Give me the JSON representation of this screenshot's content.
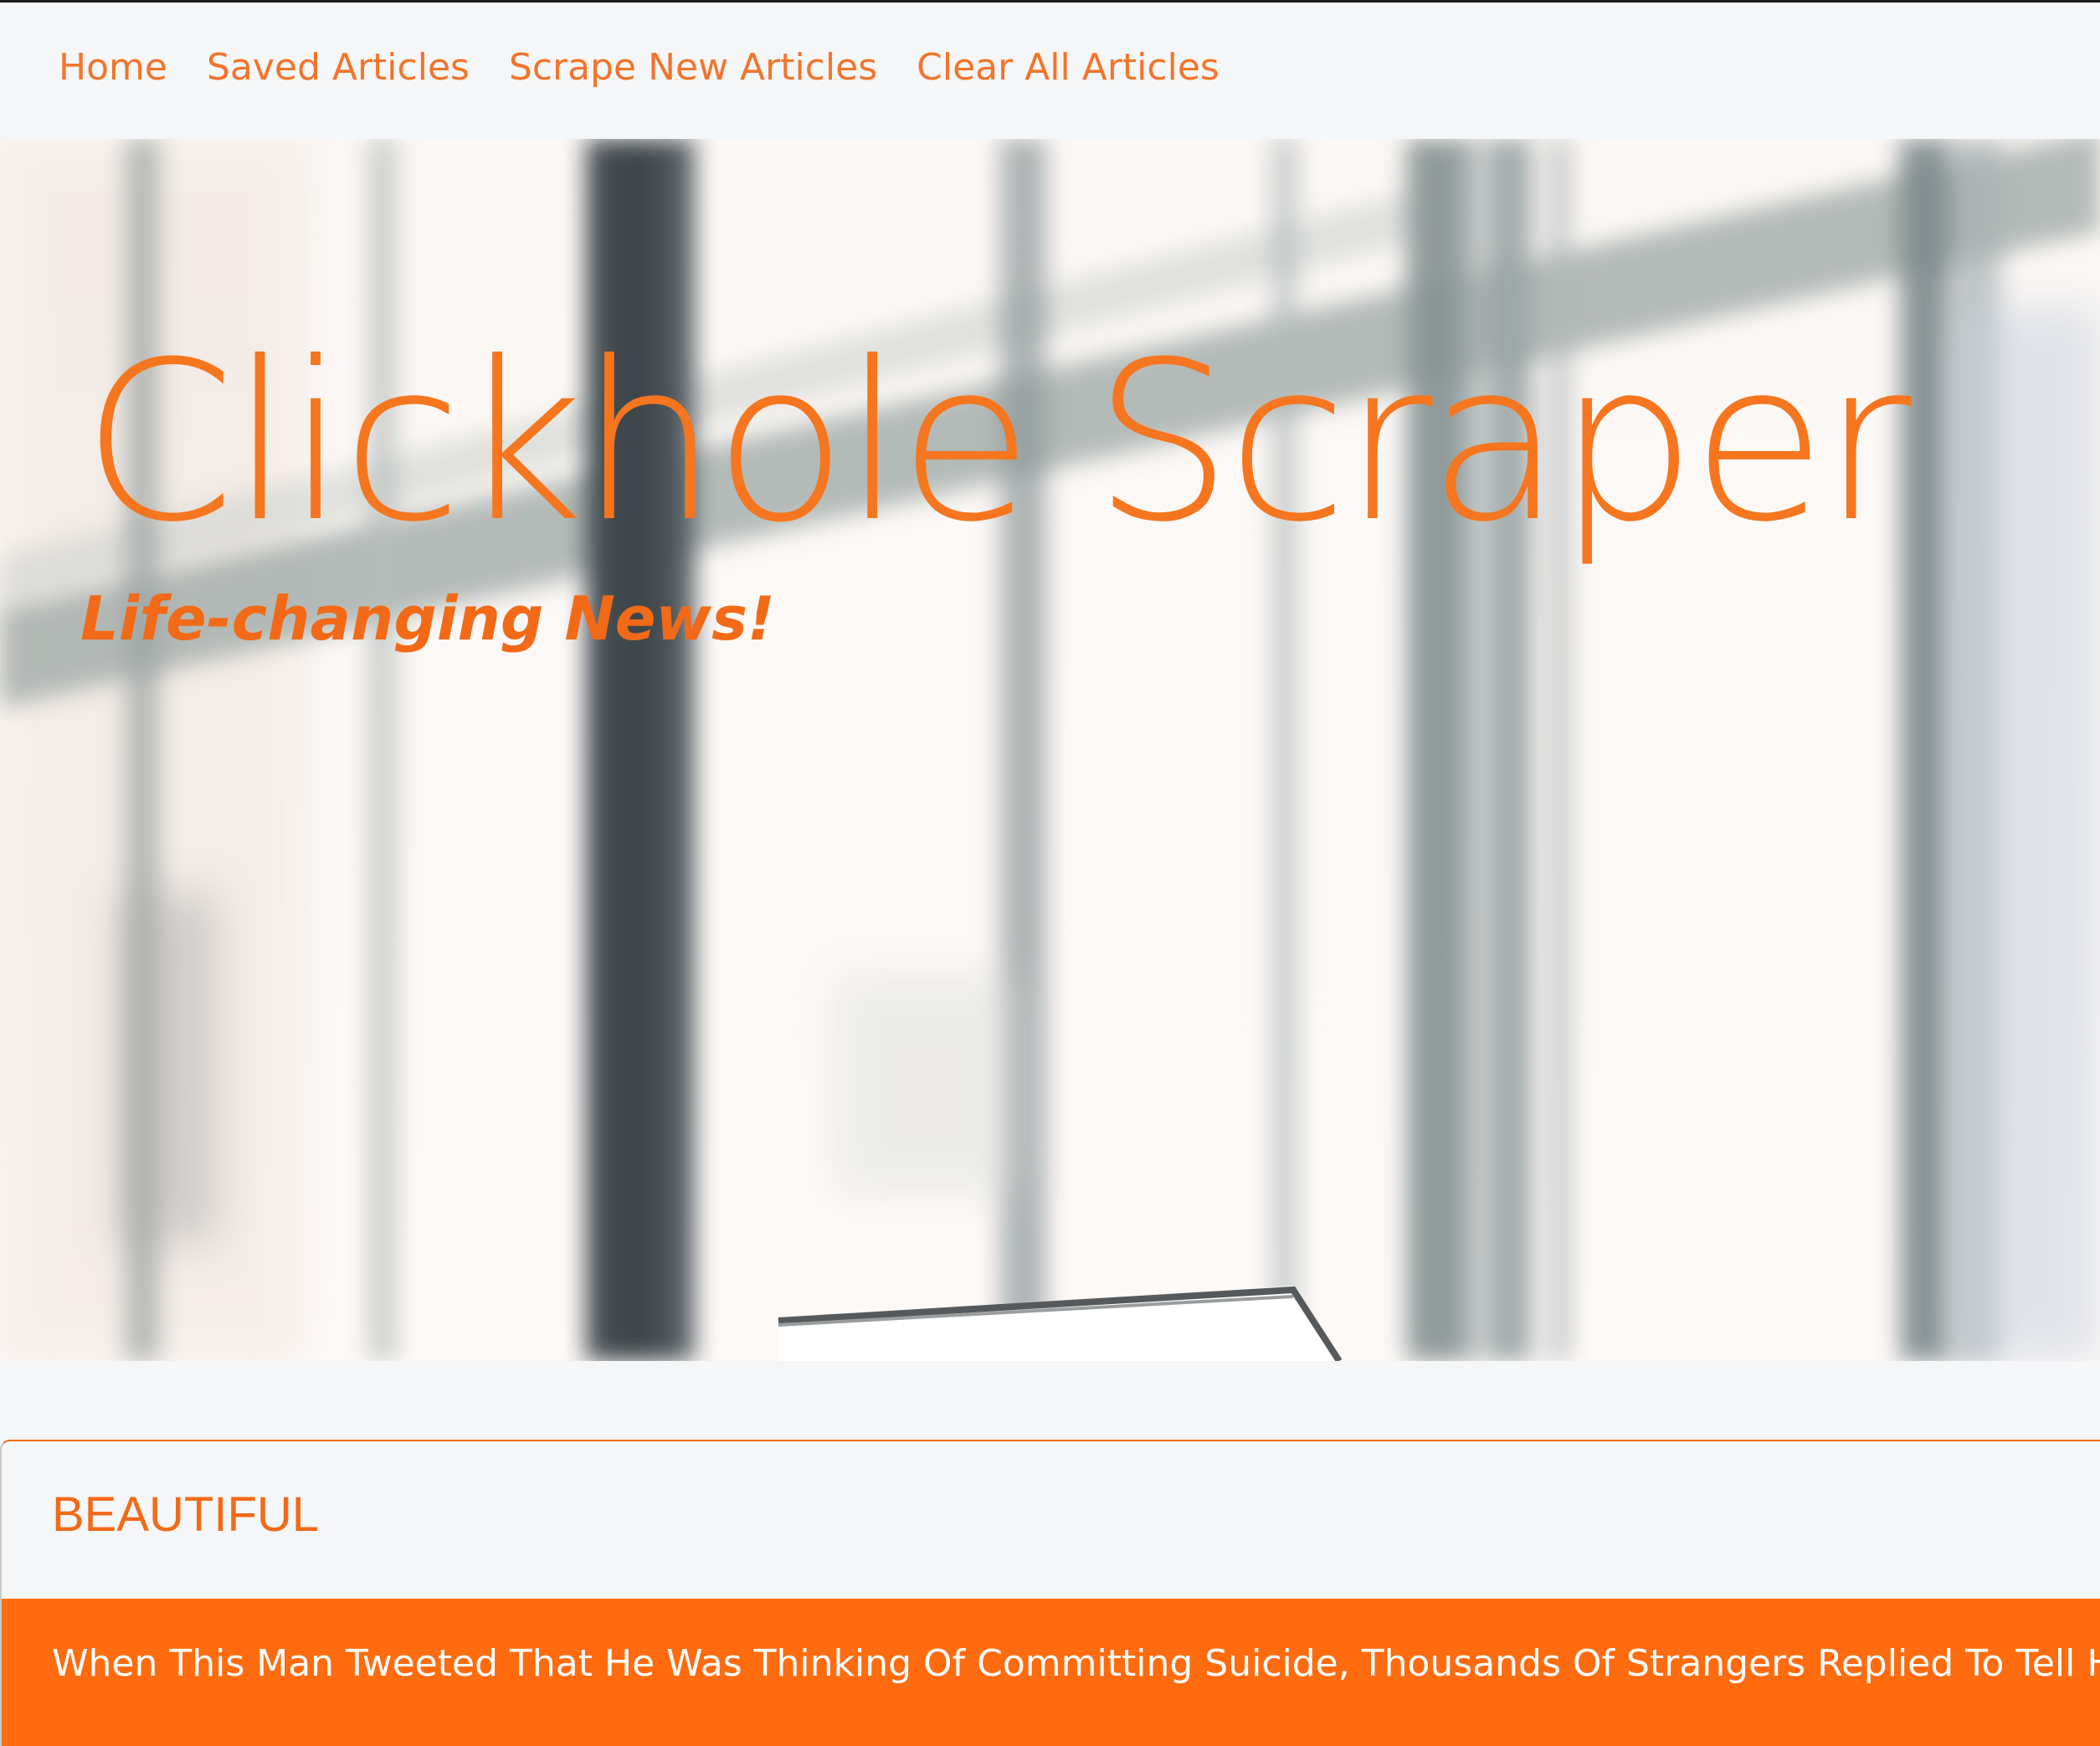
{
  "nav": {
    "items": [
      {
        "label": "Home"
      },
      {
        "label": "Saved Articles"
      },
      {
        "label": "Scrape New Articles"
      },
      {
        "label": "Clear All Articles"
      }
    ]
  },
  "hero": {
    "title": "Clickhole Scraper",
    "subtitle": "Life-changing News!"
  },
  "article": {
    "category": "BEAUTIFUL",
    "headline": "When This Man Tweeted That He Was Thinking Of Committing Suicide, Thousands Of Strangers Replied To Tell Him The"
  },
  "colors": {
    "accent": "#f26a17",
    "page_background": "#f5f6f7",
    "card_body": "#ff6b0f"
  },
  "icons": [
    "hero-background-image"
  ]
}
